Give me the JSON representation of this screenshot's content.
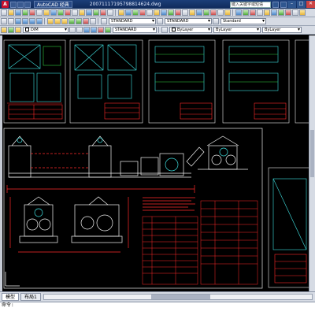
{
  "window": {
    "app_icon_letter": "A",
    "workspace": "AutoCAD 经典",
    "doc_title": "20071117195798814624.dwg",
    "search_placeholder": "键入关键字或短语",
    "close_glyph": "✕",
    "minimize_glyph": "–",
    "maximize_glyph": "□"
  },
  "toolbar2": {
    "text_style": "STANDARD",
    "dim_style": "STANDARD",
    "table_style": "Standard"
  },
  "toolbar3": {
    "layer_combo": "DIM",
    "visual_style": "STANDARD",
    "color": "ByLayer",
    "linetype": "ByLayer",
    "lineweight": "ByLayer"
  },
  "tabs": [
    "模型",
    "布局1"
  ],
  "cmdline": "命令:",
  "colors": {
    "frame": "#e8e8e8",
    "red": "#ff2a2a",
    "cyan": "#3fe0e0",
    "green": "#2ecc40",
    "yellow": "#f2e040",
    "white": "#f4f4f4"
  }
}
